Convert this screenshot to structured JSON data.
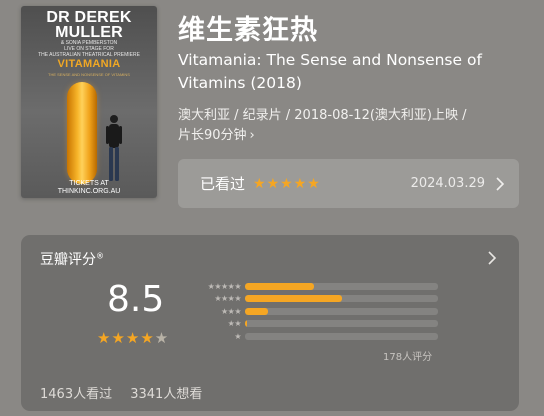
{
  "poster": {
    "name_line1": "DR DEREK",
    "name_line2": "MULLER",
    "sub_line1": "& SONIA PEMBERSTON",
    "sub_line2": "LIVE ON STAGE FOR",
    "sub_line3": "THE AUSTRALIAN THEATRICAL PREMIERE",
    "brand": "VITAMANIA",
    "tagline": "THE SENSE AND NONSENSE OF VITAMINS",
    "tickets_line1": "TICKETS AT",
    "tickets_line2": "THINKINC.ORG.AU"
  },
  "title_zh": "维生素狂热",
  "title_en": "Vitamania: The Sense and Nonsense of Vitamins (2018)",
  "meta": {
    "line1": "澳大利亚 / 纪录片 / 2018-08-12(澳大利亚)上映 /",
    "line2": "片长90分钟"
  },
  "watched": {
    "label": "已看过",
    "stars": "★★★★★",
    "date": "2024.03.29"
  },
  "rating": {
    "title": "豆瓣评分",
    "mark": "®",
    "score": "8.5",
    "stars_full": "★★★★",
    "stars_half": "★",
    "distribution": [
      {
        "stars": "★★★★★",
        "fraction": 0.36
      },
      {
        "stars": "★★★★",
        "fraction": 0.5
      },
      {
        "stars": "★★★",
        "fraction": 0.12
      },
      {
        "stars": "★★",
        "fraction": 0.01
      },
      {
        "stars": "★",
        "fraction": 0.0
      }
    ],
    "count": "178人评分",
    "watched_count": "1463人看过",
    "want_count": "3341人想看"
  },
  "colors": {
    "accent": "#f5a623"
  }
}
